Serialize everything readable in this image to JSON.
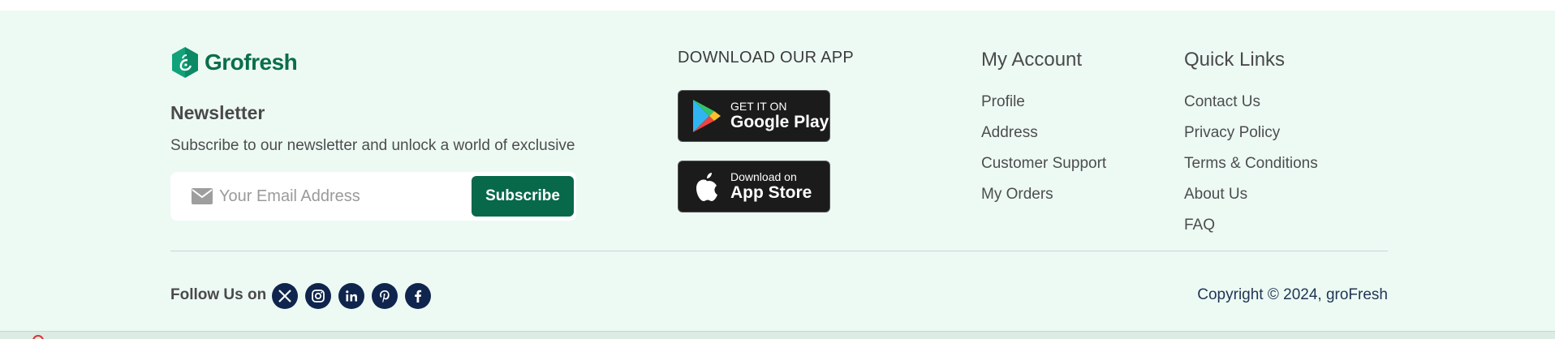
{
  "brand": {
    "name": "Grofresh"
  },
  "newsletter": {
    "title": "Newsletter",
    "description": "Subscribe to our newsletter and unlock a world of exclusive",
    "email_placeholder": "Your Email Address",
    "subscribe_label": "Subscribe"
  },
  "download": {
    "title": "DOWNLOAD OUR APP",
    "google_play": {
      "small": "GET IT ON",
      "big": "Google Play"
    },
    "app_store": {
      "small": "Download on",
      "big": "App Store"
    }
  },
  "my_account": {
    "title": "My Account",
    "items": [
      "Profile",
      "Address",
      "Customer Support",
      "My Orders"
    ]
  },
  "quick_links": {
    "title": "Quick Links",
    "items": [
      "Contact Us",
      "Privacy Policy",
      "Terms & Conditions",
      "About Us",
      "FAQ"
    ]
  },
  "social": {
    "label": "Follow Us on",
    "icons": [
      "x-icon",
      "instagram-icon",
      "linkedin-icon",
      "pinterest-icon",
      "facebook-icon"
    ]
  },
  "copyright": "Copyright © 2024, groFresh",
  "colors": {
    "brand_green": "#08684a",
    "footer_bg": "#edfaf4",
    "social_bg": "#10254d"
  }
}
